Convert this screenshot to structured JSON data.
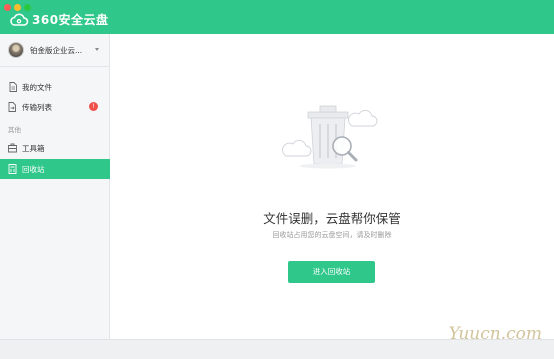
{
  "app": {
    "title": "360安全云盘"
  },
  "sidebar": {
    "account_name": "铂金版企业云...",
    "items": [
      {
        "label": "我的文件",
        "icon": "file-icon"
      },
      {
        "label": "传输列表",
        "icon": "transfer-icon",
        "badge": "!"
      },
      {
        "label": "工具箱",
        "icon": "toolbox-icon"
      },
      {
        "label": "回收站",
        "icon": "recycle-bin-icon",
        "active": true
      }
    ],
    "group_label": "其他"
  },
  "main": {
    "empty_title": "文件误删，云盘帮你保管",
    "empty_subtitle": "回收站占用您的云盘空间，请及时删除",
    "action_label": "进入回收站"
  },
  "watermark": "Yuucn.com",
  "colors": {
    "accent": "#2fc78a",
    "badge": "#f0504a"
  }
}
